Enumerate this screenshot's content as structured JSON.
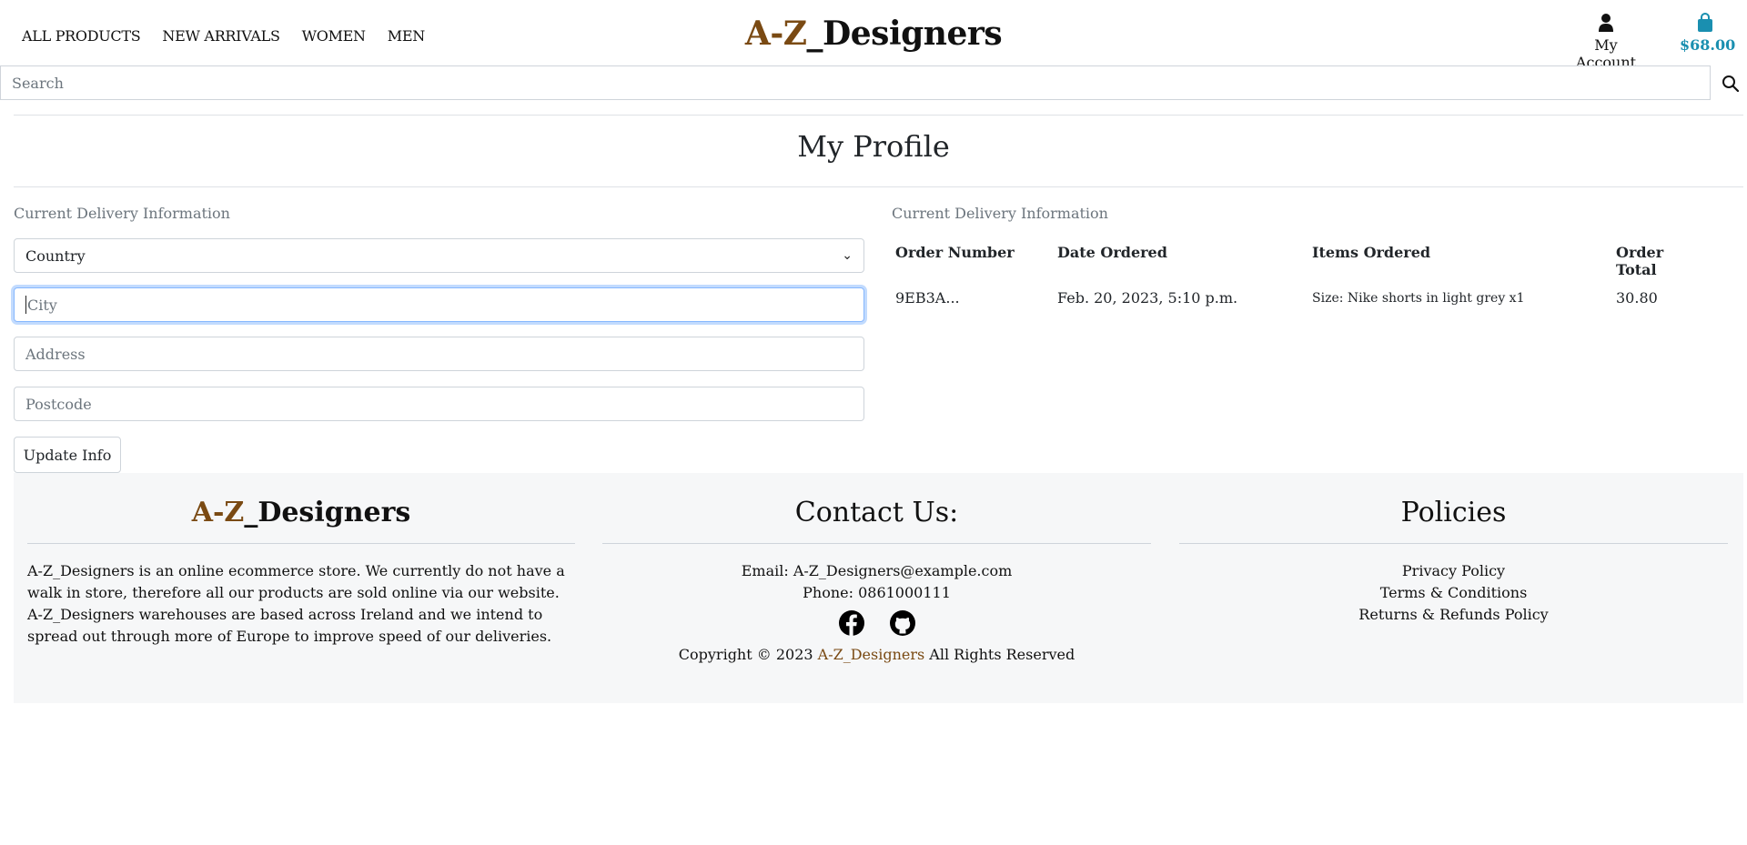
{
  "header": {
    "nav": [
      "ALL PRODUCTS",
      "NEW ARRIVALS",
      "WOMEN",
      "MEN"
    ],
    "brand_az": "A-Z",
    "brand_rest": "_Designers",
    "account_label": "My Account",
    "cart_total": "$68.00"
  },
  "search": {
    "placeholder": "Search"
  },
  "page": {
    "title": "My Profile"
  },
  "delivery": {
    "section_label": "Current Delivery Information",
    "country_value": "Country",
    "city_placeholder": "City",
    "address_placeholder": "Address",
    "postcode_placeholder": "Postcode",
    "update_label": "Update Info"
  },
  "orders": {
    "section_label": "Current Delivery Information",
    "columns": [
      "Order Number",
      "Date Ordered",
      "Items Ordered",
      "Order Total"
    ],
    "rows": [
      [
        "9EB3A...",
        "Feb. 20, 2023, 5:10 p.m.",
        "Size: Nike shorts in light grey x1",
        "30.80"
      ]
    ]
  },
  "footer": {
    "brand_az": "A-Z",
    "brand_rest": "_Designers",
    "about": "A-Z_Designers is an online ecommerce store. We currently do not have a walk in store, therefore all our products are sold online via our website. A-Z_Designers warehouses are based across Ireland and we intend to spread out through more of Europe to improve speed of our deliveries.",
    "contact_title": "Contact Us:",
    "email": "Email: A-Z_Designers@example.com",
    "phone": "Phone: 0861000111",
    "copyright_pre": "Copyright © 2023 ",
    "copyright_brand": "A-Z_Designers",
    "copyright_post": " All Rights Reserved",
    "policies_title": "Policies",
    "policies": [
      "Privacy Policy",
      "Terms & Conditions",
      "Returns & Refunds Policy"
    ]
  },
  "colors": {
    "brand_accent": "#7a4a13",
    "cart": "#1a8fb0",
    "footer_bg": "#f6f7f8"
  },
  "icons": {
    "account": "person-icon",
    "cart": "shopping-bag-icon",
    "search": "search-icon",
    "facebook": "facebook-icon",
    "github": "github-icon"
  }
}
